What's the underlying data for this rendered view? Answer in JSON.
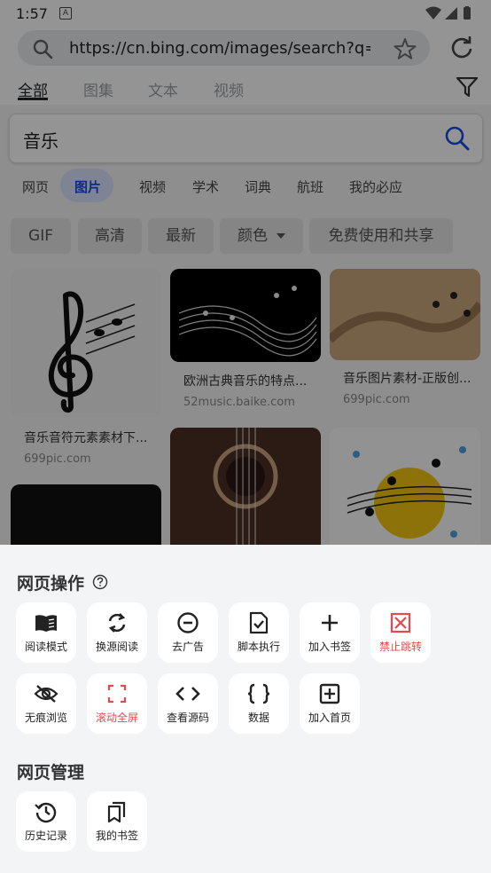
{
  "status_bar": {
    "time": "1:57",
    "notification_glyph": "A"
  },
  "browser": {
    "url": "https://cn.bing.com/images/search?q=%E",
    "tabs": [
      "全部",
      "图集",
      "文本",
      "视频"
    ]
  },
  "bing": {
    "query": "音乐",
    "nav": [
      "网页",
      "图片",
      "视频",
      "学术",
      "词典",
      "航班",
      "我的必应"
    ],
    "filters": [
      "GIF",
      "高清",
      "最新",
      "颜色",
      "免费使用和共享"
    ],
    "results": [
      {
        "caption": "音乐音符元素素材下...",
        "source": "699pic.com"
      },
      {
        "caption": "欧洲古典音乐的特点...",
        "source": "52music.baike.com"
      },
      {
        "caption": "音乐图片素材-正版创...",
        "source": "699pic.com"
      }
    ]
  },
  "sheet": {
    "section1_title": "网页操作",
    "actions": [
      {
        "label": "阅读模式",
        "icon": "book-open-icon"
      },
      {
        "label": "换源阅读",
        "icon": "refresh-icon"
      },
      {
        "label": "去广告",
        "icon": "minus-circle-icon"
      },
      {
        "label": "脚本执行",
        "icon": "script-check-icon"
      },
      {
        "label": "加入书签",
        "icon": "plus-icon"
      },
      {
        "label": "禁止跳转",
        "icon": "block-redirect-icon",
        "color": "#e5484d"
      },
      {
        "label": "无痕浏览",
        "icon": "eye-off-icon"
      },
      {
        "label": "滚动全屏",
        "icon": "fullscreen-icon",
        "color": "#e5484d"
      },
      {
        "label": "查看源码",
        "icon": "code-icon"
      },
      {
        "label": "数据",
        "icon": "braces-icon"
      },
      {
        "label": "加入首页",
        "icon": "add-home-icon"
      }
    ],
    "section2_title": "网页管理",
    "manage": [
      {
        "label": "历史记录",
        "icon": "history-icon"
      },
      {
        "label": "我的书签",
        "icon": "bookmarks-icon"
      }
    ]
  },
  "colors": {
    "accent_red": "#e5484d",
    "bing_blue": "#174ae4",
    "sheet_bg": "#f3f4f6"
  }
}
